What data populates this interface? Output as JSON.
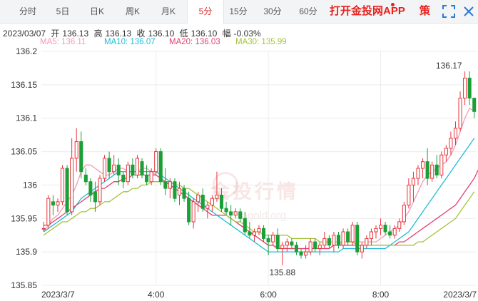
{
  "tabs": [
    {
      "label": "分时",
      "active": false
    },
    {
      "label": "5日",
      "active": false
    },
    {
      "label": "日K",
      "active": false
    },
    {
      "label": "周K",
      "active": false
    },
    {
      "label": "月K",
      "active": false
    },
    {
      "label": "5分",
      "active": true
    },
    {
      "label": "15分",
      "active": false
    },
    {
      "label": "30分",
      "active": false
    },
    {
      "label": "60分",
      "active": false
    }
  ],
  "promo": "打开金投网APP",
  "strategy_label": "策",
  "info": {
    "date": "2023/03/07",
    "open_label": "开",
    "open": "136.13",
    "high_label": "高",
    "high": "136.13",
    "close_label": "收",
    "close": "136.10",
    "low_label": "低",
    "low": "136.10",
    "change_label": "幅",
    "change": "-0.03%"
  },
  "ma": {
    "ma5": "MA5: 136.11",
    "ma10": "MA10: 136.07",
    "ma20": "MA20: 136.03",
    "ma30": "MA30: 135.99"
  },
  "watermark": {
    "text": "金投行情",
    "sub": "cngold.org"
  },
  "colors": {
    "up": "#e8333a",
    "down": "#1aa037",
    "ma5": "#f29bb4",
    "ma10": "#20bcd6",
    "ma20": "#e43f6f",
    "ma30": "#a5c43a",
    "grid": "#ececec",
    "axis_text": "#333333"
  },
  "chart_data": {
    "type": "candlestick",
    "interval": "5分",
    "ylim": [
      135.85,
      136.2
    ],
    "y_ticks": [
      "136.2",
      "136.15",
      "136.1",
      "136.05",
      "136",
      "135.95",
      "135.9",
      "135.85"
    ],
    "x_tick_labels": [
      "2023/3/7",
      "4:00",
      "6:00",
      "8:00",
      "2023/3/7"
    ],
    "annotations": {
      "high": "136.17",
      "low": "135.88"
    },
    "candles": [
      [
        135.935,
        135.945,
        135.93,
        135.935
      ],
      [
        135.94,
        135.985,
        135.935,
        135.98
      ],
      [
        135.975,
        135.985,
        135.955,
        135.97
      ],
      [
        135.97,
        135.98,
        135.96,
        135.975
      ],
      [
        135.975,
        136.03,
        135.97,
        136.025
      ],
      [
        136.025,
        136.03,
        135.955,
        135.96
      ],
      [
        135.96,
        136.07,
        135.955,
        136.04
      ],
      [
        136.04,
        136.085,
        136.02,
        136.065
      ],
      [
        136.065,
        136.08,
        136.01,
        136.02
      ],
      [
        136.015,
        136.025,
        136.0,
        136.005
      ],
      [
        136.005,
        136.01,
        135.975,
        135.985
      ],
      [
        135.99,
        136.005,
        135.96,
        135.975
      ],
      [
        135.975,
        136.015,
        135.97,
        136.01
      ],
      [
        136.01,
        136.045,
        136.005,
        136.04
      ],
      [
        136.04,
        136.05,
        136.01,
        136.02
      ],
      [
        136.02,
        136.045,
        136.015,
        136.03
      ],
      [
        136.03,
        136.04,
        136.0,
        136.015
      ],
      [
        136.015,
        136.02,
        135.995,
        136.005
      ],
      [
        136.005,
        136.035,
        136.0,
        136.03
      ],
      [
        136.03,
        136.04,
        136.01,
        136.015
      ],
      [
        136.015,
        136.045,
        136.01,
        136.04
      ],
      [
        136.035,
        136.04,
        136.01,
        136.015
      ],
      [
        136.015,
        136.03,
        136.0,
        136.005
      ],
      [
        136.005,
        136.025,
        136.0,
        136.02
      ],
      [
        136.02,
        136.055,
        136.015,
        136.05
      ],
      [
        136.05,
        136.055,
        136.0,
        136.005
      ],
      [
        136.005,
        136.025,
        135.985,
        135.995
      ],
      [
        135.995,
        136.01,
        135.98,
        136.005
      ],
      [
        136.005,
        136.01,
        135.975,
        135.98
      ],
      [
        135.985,
        136.005,
        135.97,
        135.995
      ],
      [
        135.995,
        136.0,
        135.975,
        135.98
      ],
      [
        135.98,
        135.99,
        135.94,
        135.945
      ],
      [
        135.945,
        135.98,
        135.935,
        135.975
      ],
      [
        135.975,
        135.99,
        135.96,
        135.985
      ],
      [
        135.985,
        135.995,
        135.96,
        135.965
      ],
      [
        135.965,
        135.975,
        135.95,
        135.97
      ],
      [
        135.97,
        135.985,
        135.96,
        135.98
      ],
      [
        135.98,
        136.02,
        135.975,
        135.985
      ],
      [
        135.985,
        135.995,
        135.96,
        135.965
      ],
      [
        135.965,
        135.975,
        135.955,
        135.96
      ],
      [
        135.96,
        135.97,
        135.94,
        135.955
      ],
      [
        135.955,
        135.965,
        135.95,
        135.96
      ],
      [
        135.96,
        135.965,
        135.945,
        135.95
      ],
      [
        135.95,
        135.96,
        135.925,
        135.93
      ],
      [
        135.93,
        135.945,
        135.92,
        135.925
      ],
      [
        135.925,
        135.935,
        135.915,
        135.93
      ],
      [
        135.93,
        135.94,
        135.925,
        135.935
      ],
      [
        135.935,
        135.94,
        135.915,
        135.92
      ],
      [
        135.92,
        135.925,
        135.895,
        135.915
      ],
      [
        135.915,
        135.93,
        135.91,
        135.925
      ],
      [
        135.925,
        135.935,
        135.9,
        135.905
      ],
      [
        135.905,
        135.915,
        135.88,
        135.91
      ],
      [
        135.91,
        135.92,
        135.9,
        135.915
      ],
      [
        135.915,
        135.92,
        135.905,
        135.91
      ],
      [
        135.91,
        135.915,
        135.895,
        135.9
      ],
      [
        135.9,
        135.905,
        135.89,
        135.895
      ],
      [
        135.895,
        135.91,
        135.89,
        135.9
      ],
      [
        135.9,
        135.92,
        135.895,
        135.915
      ],
      [
        135.915,
        135.92,
        135.9,
        135.905
      ],
      [
        135.905,
        135.915,
        135.895,
        135.91
      ],
      [
        135.91,
        135.93,
        135.905,
        135.92
      ],
      [
        135.92,
        135.925,
        135.905,
        135.91
      ],
      [
        135.91,
        135.93,
        135.9,
        135.925
      ],
      [
        135.925,
        135.93,
        135.905,
        135.91
      ],
      [
        135.91,
        135.935,
        135.905,
        135.93
      ],
      [
        135.93,
        135.935,
        135.91,
        135.915
      ],
      [
        135.915,
        135.945,
        135.91,
        135.94
      ],
      [
        135.94,
        135.945,
        135.895,
        135.9
      ],
      [
        135.9,
        135.915,
        135.89,
        135.91
      ],
      [
        135.91,
        135.925,
        135.905,
        135.92
      ],
      [
        135.92,
        135.935,
        135.91,
        135.93
      ],
      [
        135.93,
        135.94,
        135.92,
        135.935
      ],
      [
        135.935,
        135.95,
        135.925,
        135.94
      ],
      [
        135.94,
        135.945,
        135.925,
        135.93
      ],
      [
        135.93,
        135.94,
        135.92,
        135.925
      ],
      [
        135.925,
        135.94,
        135.92,
        135.935
      ],
      [
        135.935,
        135.95,
        135.93,
        135.945
      ],
      [
        135.945,
        135.975,
        135.94,
        135.97
      ],
      [
        135.97,
        136.01,
        135.965,
        136.0
      ],
      [
        136.0,
        136.02,
        135.975,
        136.01
      ],
      [
        136.01,
        136.03,
        136.0,
        136.025
      ],
      [
        136.025,
        136.04,
        136.01,
        136.035
      ],
      [
        136.035,
        136.055,
        136.0,
        136.01
      ],
      [
        136.01,
        136.035,
        136.005,
        136.03
      ],
      [
        136.03,
        136.045,
        136.01,
        136.015
      ],
      [
        136.015,
        136.05,
        136.01,
        136.045
      ],
      [
        136.045,
        136.06,
        136.035,
        136.055
      ],
      [
        136.055,
        136.08,
        136.045,
        136.07
      ],
      [
        136.07,
        136.095,
        136.06,
        136.085
      ],
      [
        136.085,
        136.14,
        136.08,
        136.13
      ],
      [
        136.13,
        136.17,
        136.12,
        136.16
      ],
      [
        136.16,
        136.17,
        136.12,
        136.13
      ],
      [
        136.13,
        136.13,
        136.1,
        136.11
      ]
    ],
    "ma_series": [
      {
        "name": "MA5",
        "values": [
          135.93,
          135.94,
          135.95,
          135.955,
          135.965,
          135.975,
          135.985,
          136.0,
          136.02,
          136.03,
          136.03,
          136.025,
          136.02,
          136.015,
          136.015,
          136.02,
          136.025,
          136.025,
          136.02,
          136.02,
          136.02,
          136.025,
          136.025,
          136.02,
          136.015,
          136.01,
          136.005,
          136.0,
          135.995,
          135.99,
          135.985,
          135.98,
          135.975,
          135.97,
          135.965,
          135.96,
          135.955,
          135.955,
          135.955,
          135.955,
          135.95,
          135.945,
          135.94,
          135.935,
          135.93,
          135.925,
          135.92,
          135.915,
          135.91,
          135.91,
          135.905,
          135.905,
          135.905,
          135.905,
          135.905,
          135.905,
          135.905,
          135.905,
          135.905,
          135.905,
          135.905,
          135.905,
          135.91,
          135.91,
          135.915,
          135.915,
          135.915,
          135.915,
          135.915,
          135.915,
          135.915,
          135.915,
          135.92,
          135.925,
          135.93,
          135.935,
          135.94,
          135.95,
          135.96,
          135.975,
          135.99,
          136.005,
          136.015,
          136.02,
          136.025,
          136.03,
          136.035,
          136.045,
          136.06,
          136.08,
          136.1,
          136.115,
          136.11
        ]
      },
      {
        "name": "MA10",
        "values": [
          135.93,
          135.935,
          135.94,
          135.945,
          135.95,
          135.955,
          135.96,
          135.97,
          135.98,
          135.985,
          135.99,
          135.995,
          136.0,
          136.005,
          136.01,
          136.015,
          136.02,
          136.02,
          136.02,
          136.02,
          136.02,
          136.02,
          136.02,
          136.02,
          136.02,
          136.015,
          136.01,
          136.005,
          136.0,
          135.995,
          135.99,
          135.985,
          135.98,
          135.975,
          135.97,
          135.965,
          135.96,
          135.955,
          135.95,
          135.945,
          135.94,
          135.935,
          135.93,
          135.925,
          135.92,
          135.915,
          135.91,
          135.905,
          135.9,
          135.9,
          135.9,
          135.9,
          135.9,
          135.9,
          135.9,
          135.9,
          135.9,
          135.9,
          135.9,
          135.9,
          135.9,
          135.9,
          135.9,
          135.9,
          135.905,
          135.905,
          135.905,
          135.905,
          135.905,
          135.905,
          135.905,
          135.905,
          135.905,
          135.905,
          135.91,
          135.915,
          135.92,
          135.925,
          135.93,
          135.94,
          135.95,
          135.96,
          135.97,
          135.98,
          135.99,
          136.0,
          136.01,
          136.02,
          136.03,
          136.04,
          136.05,
          136.06,
          136.07
        ]
      },
      {
        "name": "MA20",
        "values": [
          135.94,
          135.94,
          135.945,
          135.95,
          135.955,
          135.96,
          135.965,
          135.97,
          135.975,
          135.98,
          135.985,
          135.99,
          135.995,
          135.995,
          136.0,
          136.005,
          136.005,
          136.01,
          136.01,
          136.015,
          136.015,
          136.015,
          136.015,
          136.015,
          136.015,
          136.01,
          136.005,
          136.0,
          135.995,
          135.99,
          135.985,
          135.98,
          135.975,
          135.97,
          135.965,
          135.96,
          135.955,
          135.955,
          135.955,
          135.955,
          135.95,
          135.945,
          135.94,
          135.935,
          135.93,
          135.925,
          135.92,
          135.915,
          135.91,
          135.91,
          135.905,
          135.905,
          135.905,
          135.905,
          135.905,
          135.905,
          135.905,
          135.905,
          135.905,
          135.905,
          135.905,
          135.905,
          135.91,
          135.91,
          135.91,
          135.91,
          135.91,
          135.91,
          135.91,
          135.91,
          135.91,
          135.91,
          135.91,
          135.91,
          135.91,
          135.91,
          135.915,
          135.915,
          135.92,
          135.925,
          135.93,
          135.935,
          135.94,
          135.945,
          135.95,
          135.955,
          135.96,
          135.965,
          135.97,
          135.98,
          135.99,
          136.0,
          136.01,
          136.025
        ]
      },
      {
        "name": "MA30",
        "values": [
          135.925,
          135.93,
          135.935,
          135.94,
          135.945,
          135.945,
          135.95,
          135.955,
          135.96,
          135.96,
          135.965,
          135.965,
          135.97,
          135.975,
          135.975,
          135.98,
          135.985,
          135.99,
          135.99,
          135.995,
          135.995,
          136.0,
          136.0,
          136.005,
          136.005,
          136.005,
          136.005,
          136.005,
          136.0,
          136.0,
          135.995,
          135.995,
          135.99,
          135.985,
          135.98,
          135.975,
          135.97,
          135.965,
          135.96,
          135.955,
          135.95,
          135.945,
          135.945,
          135.94,
          135.935,
          135.93,
          135.93,
          135.925,
          135.925,
          135.925,
          135.925,
          135.925,
          135.925,
          135.92,
          135.92,
          135.92,
          135.92,
          135.92,
          135.92,
          135.915,
          135.915,
          135.915,
          135.915,
          135.915,
          135.915,
          135.915,
          135.915,
          135.91,
          135.91,
          135.91,
          135.91,
          135.91,
          135.91,
          135.91,
          135.91,
          135.91,
          135.91,
          135.91,
          135.91,
          135.91,
          135.915,
          135.915,
          135.92,
          135.925,
          135.93,
          135.935,
          135.94,
          135.945,
          135.95,
          135.96,
          135.97,
          135.98,
          135.99
        ]
      }
    ]
  }
}
